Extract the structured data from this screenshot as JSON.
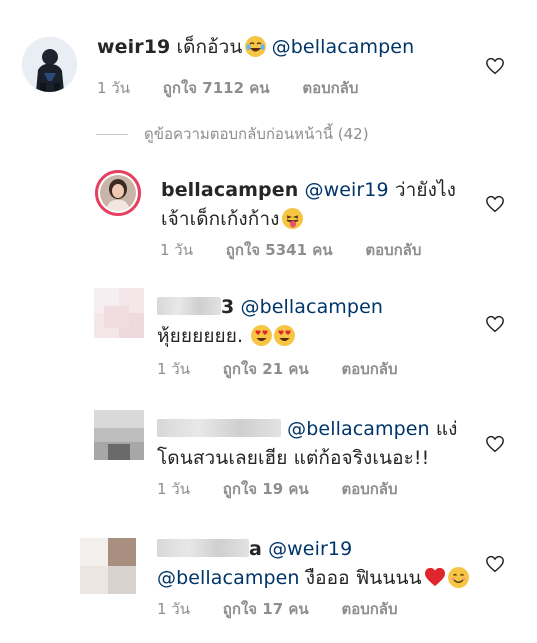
{
  "comments": [
    {
      "username": "weir19",
      "text": "เด็กอ้วน",
      "mention": "@bellacampen",
      "time": "1 วัน",
      "likes": "ถูกใจ 7112 คน",
      "reply": "ตอบกลับ"
    },
    {
      "username": "bellacampen",
      "mention": "@weir19",
      "text_line1": "ว่ายังไง",
      "text_line2": "เจ้าเด็กเก้งก้าง",
      "time": "1 วัน",
      "likes": "ถูกใจ 5341 คน",
      "reply": "ตอบกลับ"
    },
    {
      "username_visible": "3",
      "mention": "@bellacampen",
      "text": "หุ้ยยยยยย.",
      "time": "1 วัน",
      "likes": "ถูกใจ 21 คน",
      "reply": "ตอบกลับ"
    },
    {
      "mention": "@bellacampen",
      "text_line1_end": "แง่",
      "text_line2": "โดนสวนเลยเฮีย แต่ก้อจริงเนอะ!!",
      "time": "1 วัน",
      "likes": "ถูกใจ 19 คน",
      "reply": "ตอบกลับ"
    },
    {
      "username_visible": "a",
      "mention1": "@weir19",
      "mention2": "@bellacampen",
      "text": "งือออ ฟินนนน",
      "time": "1 วัน",
      "likes": "ถูกใจ 17 คน",
      "reply": "ตอบกลับ"
    }
  ],
  "view_replies": "ดูข้อความตอบกลับก่อนหน้านี้ (42)",
  "icons": {
    "like": "heart-outline-icon"
  },
  "colors": {
    "text": "#262626",
    "meta": "#8e8e8e",
    "mention": "#003569",
    "story_ring": "#e4405f",
    "heart_emoji": "#e0262d"
  }
}
